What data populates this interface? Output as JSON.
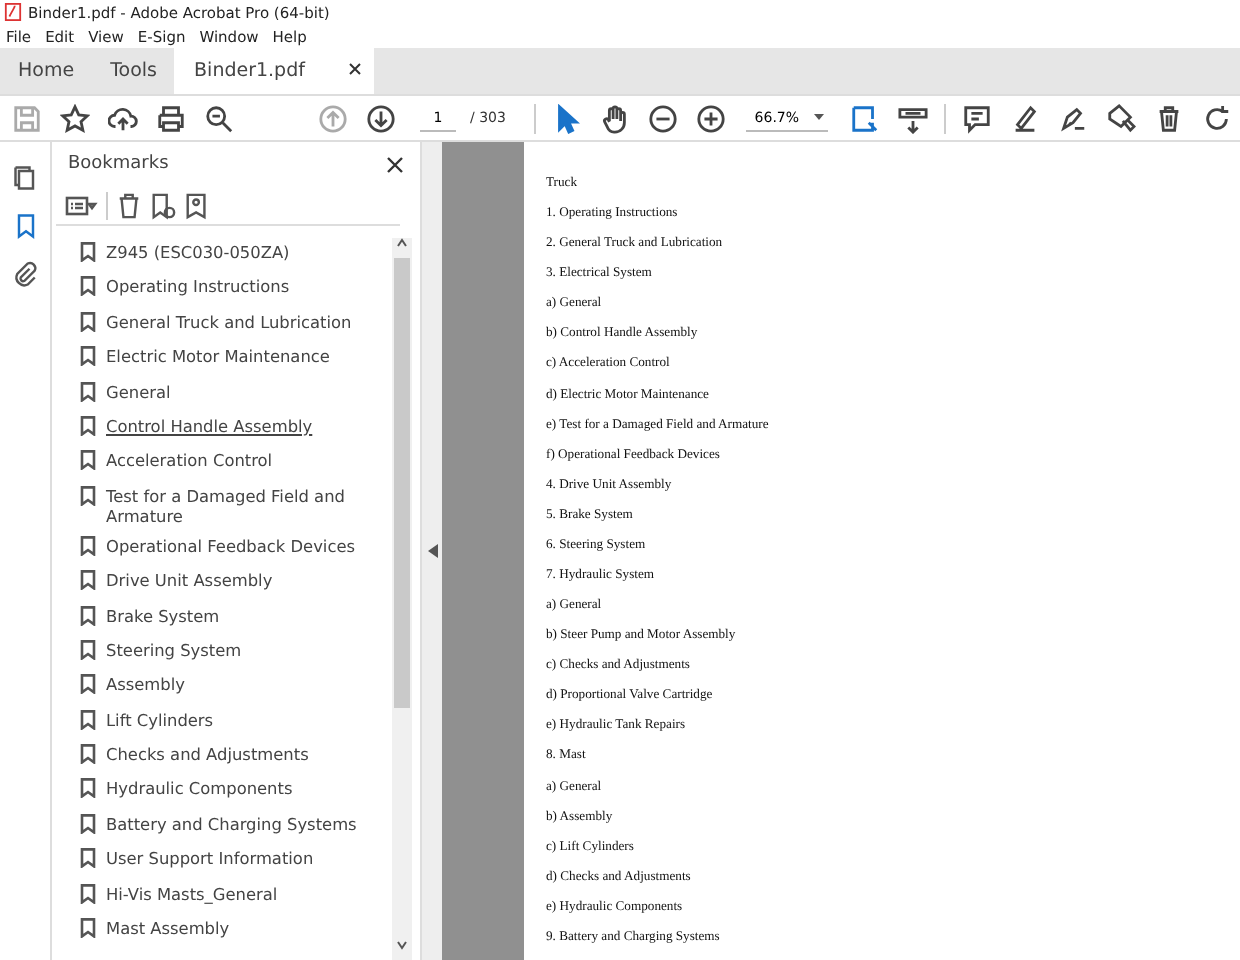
{
  "window": {
    "title": "Binder1.pdf - Adobe Acrobat Pro (64-bit)"
  },
  "menu": [
    "File",
    "Edit",
    "View",
    "E-Sign",
    "Window",
    "Help"
  ],
  "tabs": [
    {
      "label": "Home",
      "selected": false
    },
    {
      "label": "Tools",
      "selected": false
    },
    {
      "label": "Binder1.pdf",
      "selected": true,
      "closable": true
    }
  ],
  "toolbar": {
    "buttons": [
      {
        "disabled": true,
        "selected": false
      },
      {
        "disabled": false,
        "selected": false
      },
      {
        "disabled": false,
        "selected": false
      },
      {
        "disabled": false,
        "selected": false
      },
      {
        "disabled": false,
        "selected": false
      },
      {
        "disabled": true,
        "selected": false
      },
      {
        "disabled": false,
        "selected": false
      }
    ],
    "page_number": "1",
    "page_total": "/ 303",
    "tools": [
      {
        "selected": true
      },
      {
        "selected": false
      },
      {
        "selected": false
      },
      {
        "selected": false
      }
    ],
    "zoom": "66.7%",
    "view_tools": [
      {
        "selected": true
      },
      {
        "selected": false
      }
    ],
    "edit_tools": [
      {
        "selected": false
      },
      {
        "selected": false
      },
      {
        "selected": false
      },
      {
        "selected": false
      },
      {
        "selected": false
      },
      {
        "selected": false
      }
    ]
  },
  "side_rail": [
    {
      "selected": false
    },
    {
      "selected": true
    },
    {
      "selected": false
    }
  ],
  "bookmarks": {
    "title": "Bookmarks",
    "items": [
      {
        "label": "Z945 (ESC030-050ZA)",
        "hovered": false
      },
      {
        "label": "Operating Instructions",
        "hovered": false
      },
      {
        "label": "General Truck and Lubrication",
        "hovered": false
      },
      {
        "label": "Electric Motor Maintenance",
        "hovered": false
      },
      {
        "label": "General",
        "hovered": false
      },
      {
        "label": "Control Handle Assembly",
        "hovered": true
      },
      {
        "label": "Acceleration Control",
        "hovered": false
      },
      {
        "label": "Test for a Damaged Field and Armature",
        "hovered": false
      },
      {
        "label": "Operational Feedback Devices",
        "hovered": false
      },
      {
        "label": "Drive Unit Assembly",
        "hovered": false
      },
      {
        "label": "Brake System",
        "hovered": false
      },
      {
        "label": "Steering System",
        "hovered": false
      },
      {
        "label": "Assembly",
        "hovered": false
      },
      {
        "label": "Lift Cylinders",
        "hovered": false
      },
      {
        "label": "Checks and Adjustments",
        "hovered": false
      },
      {
        "label": "Hydraulic Components",
        "hovered": false
      },
      {
        "label": "Battery and Charging Systems",
        "hovered": false
      },
      {
        "label": "User Support Information",
        "hovered": false
      },
      {
        "label": "Hi-Vis Masts_General",
        "hovered": false
      },
      {
        "label": "Mast Assembly",
        "hovered": false
      }
    ]
  },
  "page": {
    "lines": [
      "Truck",
      "1.  Operating Instructions",
      "2.  General Truck and Lubrication",
      "3. Electrical System",
      "a)  General",
      "b)  Control Handle Assembly",
      "c)  Acceleration Control",
      "d)  Electric Motor Maintenance",
      "e)  Test for a Damaged Field and Armature",
      "f)  Operational Feedback Devices",
      "4.  Drive Unit Assembly",
      "5.  Brake System",
      "6.  Steering System",
      "7. Hydraulic System",
      "a)  General",
      "b)  Steer Pump and Motor Assembly",
      "c)  Checks and Adjustments",
      "d)  Proportional Valve Cartridge",
      "e)  Hydraulic Tank Repairs",
      "8. Mast",
      "a)  General",
      "b)  Assembly",
      "c)  Lift Cylinders",
      "d)  Checks and Adjustments",
      "e)  Hydraulic Components",
      "9.  Battery and Charging Systems"
    ]
  }
}
